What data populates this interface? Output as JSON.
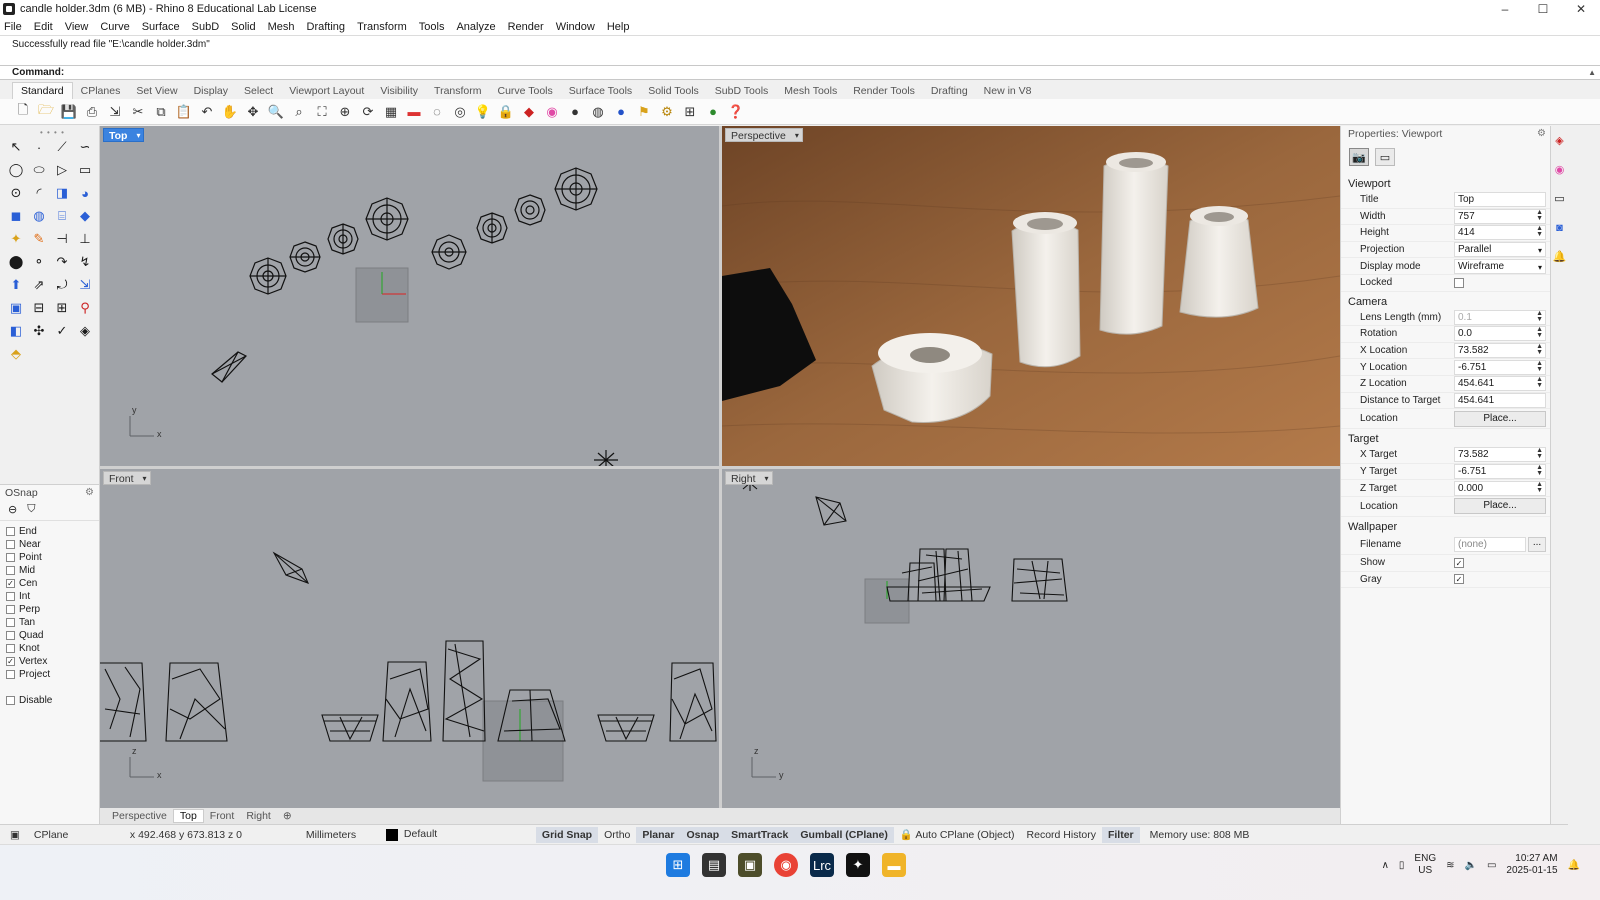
{
  "window": {
    "title": "candle holder.3dm (6 MB) - Rhino 8 Educational Lab License",
    "controls": [
      "–",
      "☐",
      "✕"
    ]
  },
  "menu": [
    "File",
    "Edit",
    "View",
    "Curve",
    "Surface",
    "SubD",
    "Solid",
    "Mesh",
    "Drafting",
    "Transform",
    "Tools",
    "Analyze",
    "Render",
    "Window",
    "Help"
  ],
  "command": {
    "history": "Successfully read file \"E:\\candle holder.3dm\"",
    "prompt": "Command:"
  },
  "toolbar_tabs": [
    "Standard",
    "CPlanes",
    "Set View",
    "Display",
    "Select",
    "Viewport Layout",
    "Visibility",
    "Transform",
    "Curve Tools",
    "Surface Tools",
    "Solid Tools",
    "SubD Tools",
    "Mesh Tools",
    "Render Tools",
    "Drafting",
    "New in V8"
  ],
  "toolbar_icons": [
    "new-icon",
    "open-icon",
    "save-icon",
    "print-icon",
    "import-icon",
    "cut-icon",
    "copy-icon",
    "paste-icon",
    "undo-icon",
    "pan-icon",
    "rotate-view-icon",
    "zoom-icon",
    "zoom-window-icon",
    "zoom-extents-icon",
    "zoom-selected-icon",
    "refresh-icon",
    "viewport-grid-icon",
    "layer-icon",
    "hide-icon",
    "show-icon",
    "light-icon",
    "lock-icon",
    "material-icon",
    "color-wheel-icon",
    "render-sphere-icon",
    "render-preview-icon",
    "render-icon",
    "options-icon",
    "properties-icon",
    "grid-icon",
    "globe-icon",
    "help-icon"
  ],
  "osnap": {
    "title": "OSnap",
    "items": [
      {
        "label": "End",
        "checked": false
      },
      {
        "label": "Near",
        "checked": false
      },
      {
        "label": "Point",
        "checked": false
      },
      {
        "label": "Mid",
        "checked": false
      },
      {
        "label": "Cen",
        "checked": true
      },
      {
        "label": "Int",
        "checked": false
      },
      {
        "label": "Perp",
        "checked": false
      },
      {
        "label": "Tan",
        "checked": false
      },
      {
        "label": "Quad",
        "checked": false
      },
      {
        "label": "Knot",
        "checked": false
      },
      {
        "label": "Vertex",
        "checked": true
      },
      {
        "label": "Project",
        "checked": false
      }
    ],
    "disable": "Disable"
  },
  "viewports": {
    "top": "Top",
    "perspective": "Perspective",
    "front": "Front",
    "right": "Right",
    "axis_x": "x",
    "axis_y": "y",
    "axis_z": "z"
  },
  "viewport_tabs": [
    "Perspective",
    "Top",
    "Front",
    "Right"
  ],
  "properties": {
    "title": "Properties: Viewport",
    "viewport_section": "Viewport",
    "title_label": "Title",
    "title_value": "Top",
    "width_label": "Width",
    "width_value": "757",
    "height_label": "Height",
    "height_value": "414",
    "projection_label": "Projection",
    "projection_value": "Parallel",
    "display_label": "Display mode",
    "display_value": "Wireframe",
    "locked_label": "Locked",
    "camera_section": "Camera",
    "lens_label": "Lens Length (mm)",
    "lens_value": "0.1",
    "rotation_label": "Rotation",
    "rotation_value": "0.0",
    "xloc_label": "X Location",
    "xloc_value": "73.582",
    "yloc_label": "Y Location",
    "yloc_value": "-6.751",
    "zloc_label": "Z Location",
    "zloc_value": "454.641",
    "dist_label": "Distance to Target",
    "dist_value": "454.641",
    "location_label": "Location",
    "place_button": "Place...",
    "target_section": "Target",
    "xt_label": "X Target",
    "xt_value": "73.582",
    "yt_label": "Y Target",
    "yt_value": "-6.751",
    "zt_label": "Z Target",
    "zt_value": "0.000",
    "wallpaper_section": "Wallpaper",
    "filename_label": "Filename",
    "filename_value": "(none)",
    "browse": "...",
    "show_label": "Show",
    "gray_label": "Gray"
  },
  "status": {
    "cplane": "CPlane",
    "coords": "x 492.468  y 673.813  z 0",
    "units": "Millimeters",
    "layer": "Default",
    "panes": [
      {
        "label": "Grid Snap",
        "on": true
      },
      {
        "label": "Ortho",
        "on": false
      },
      {
        "label": "Planar",
        "on": true
      },
      {
        "label": "Osnap",
        "on": true
      },
      {
        "label": "SmartTrack",
        "on": true
      },
      {
        "label": "Gumball (CPlane)",
        "on": true
      },
      {
        "label": "Auto CPlane (Object)",
        "on": false
      },
      {
        "label": "Record History",
        "on": false
      },
      {
        "label": "Filter",
        "on": true
      }
    ],
    "memory": "Memory use: 808 MB"
  },
  "taskbar": {
    "lang1": "ENG",
    "lang2": "US",
    "time": "10:27 AM",
    "date": "2025-01-15"
  },
  "colors": {
    "active_viewport": "#3b83e0",
    "viewport_bg": "#a0a3a8",
    "wood": "#8b5a33"
  }
}
